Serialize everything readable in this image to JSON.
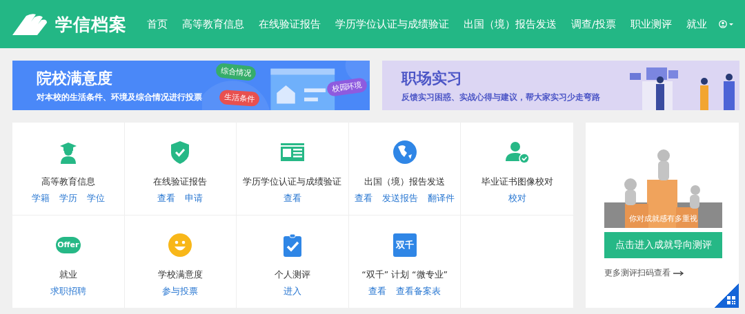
{
  "header": {
    "brand": "学信档案",
    "nav": [
      "首页",
      "高等教育信息",
      "在线验证报告",
      "学历学位认证与成绩验证",
      "出国（境）报告发送",
      "调查/投票",
      "职业测评",
      "就业"
    ]
  },
  "banners": [
    {
      "kind": "survey",
      "title": "院校满意度",
      "subtitle": "对本校的生活条件、环境及综合情况进行投票",
      "tags": [
        {
          "label": "综合情况",
          "color": "#36ad6a"
        },
        {
          "label": "生活条件",
          "color": "#e8504f"
        },
        {
          "label": "校园环境",
          "color": "#8e5bdf"
        }
      ]
    },
    {
      "kind": "intern",
      "title": "职场实习",
      "subtitle": "反馈实习困惑、实战心得与建议，帮大家实习少走弯路"
    }
  ],
  "services": [
    {
      "kind": "graduate",
      "name": "高等教育信息",
      "links": [
        "学籍",
        "学历",
        "学位"
      ]
    },
    {
      "kind": "shield",
      "name": "在线验证报告",
      "links": [
        "查看",
        "申请"
      ]
    },
    {
      "kind": "card",
      "name": "学历学位认证与成绩验证",
      "links": [
        "查看"
      ]
    },
    {
      "kind": "globe",
      "name": "出国（境）报告发送",
      "links": [
        "查看",
        "发送报告",
        "翻译件"
      ]
    },
    {
      "kind": "user",
      "name": "毕业证书图像校对",
      "links": [
        "校对"
      ]
    },
    {
      "kind": "pill",
      "icon_text": "Offer",
      "name": "就业",
      "links": [
        "求职招聘"
      ]
    },
    {
      "kind": "smile",
      "name": "学校满意度",
      "links": [
        "参与投票"
      ]
    },
    {
      "kind": "clipboard",
      "name": "个人测评",
      "links": [
        "进入"
      ]
    },
    {
      "kind": "square",
      "icon_text": "双千",
      "name": "“双千” 计划 “微专业”",
      "links": [
        "查看",
        "查看备案表"
      ]
    }
  ],
  "promo": {
    "caption": "你对成就感有多重视",
    "button": "点击进入成就导向测评",
    "more": "更多测评扫码查看"
  }
}
